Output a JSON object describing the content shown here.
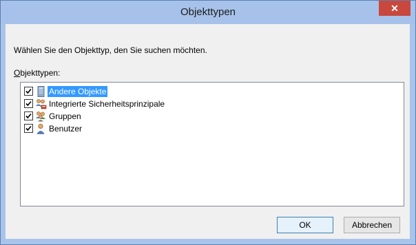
{
  "window": {
    "title": "Objekttypen",
    "close_symbol": "✕",
    "prompt": "Wählen Sie den Objekttyp, den Sie suchen möchten.",
    "list_label_first": "O",
    "list_label_rest": "bjekttypen:"
  },
  "objects": [
    {
      "label": "Andere Objekte",
      "checked": true,
      "selected": true,
      "icon": "other-objects-icon"
    },
    {
      "label": "Integrierte Sicherheitsprinzipale",
      "checked": true,
      "selected": false,
      "icon": "security-principals-icon"
    },
    {
      "label": "Gruppen",
      "checked": true,
      "selected": false,
      "icon": "groups-icon"
    },
    {
      "label": "Benutzer",
      "checked": true,
      "selected": false,
      "icon": "user-icon"
    }
  ],
  "buttons": {
    "ok": "OK",
    "cancel": "Abbrechen"
  },
  "colors": {
    "titlebar": "#a6c2ea",
    "close": "#c9483d",
    "selection": "#3399ff"
  }
}
